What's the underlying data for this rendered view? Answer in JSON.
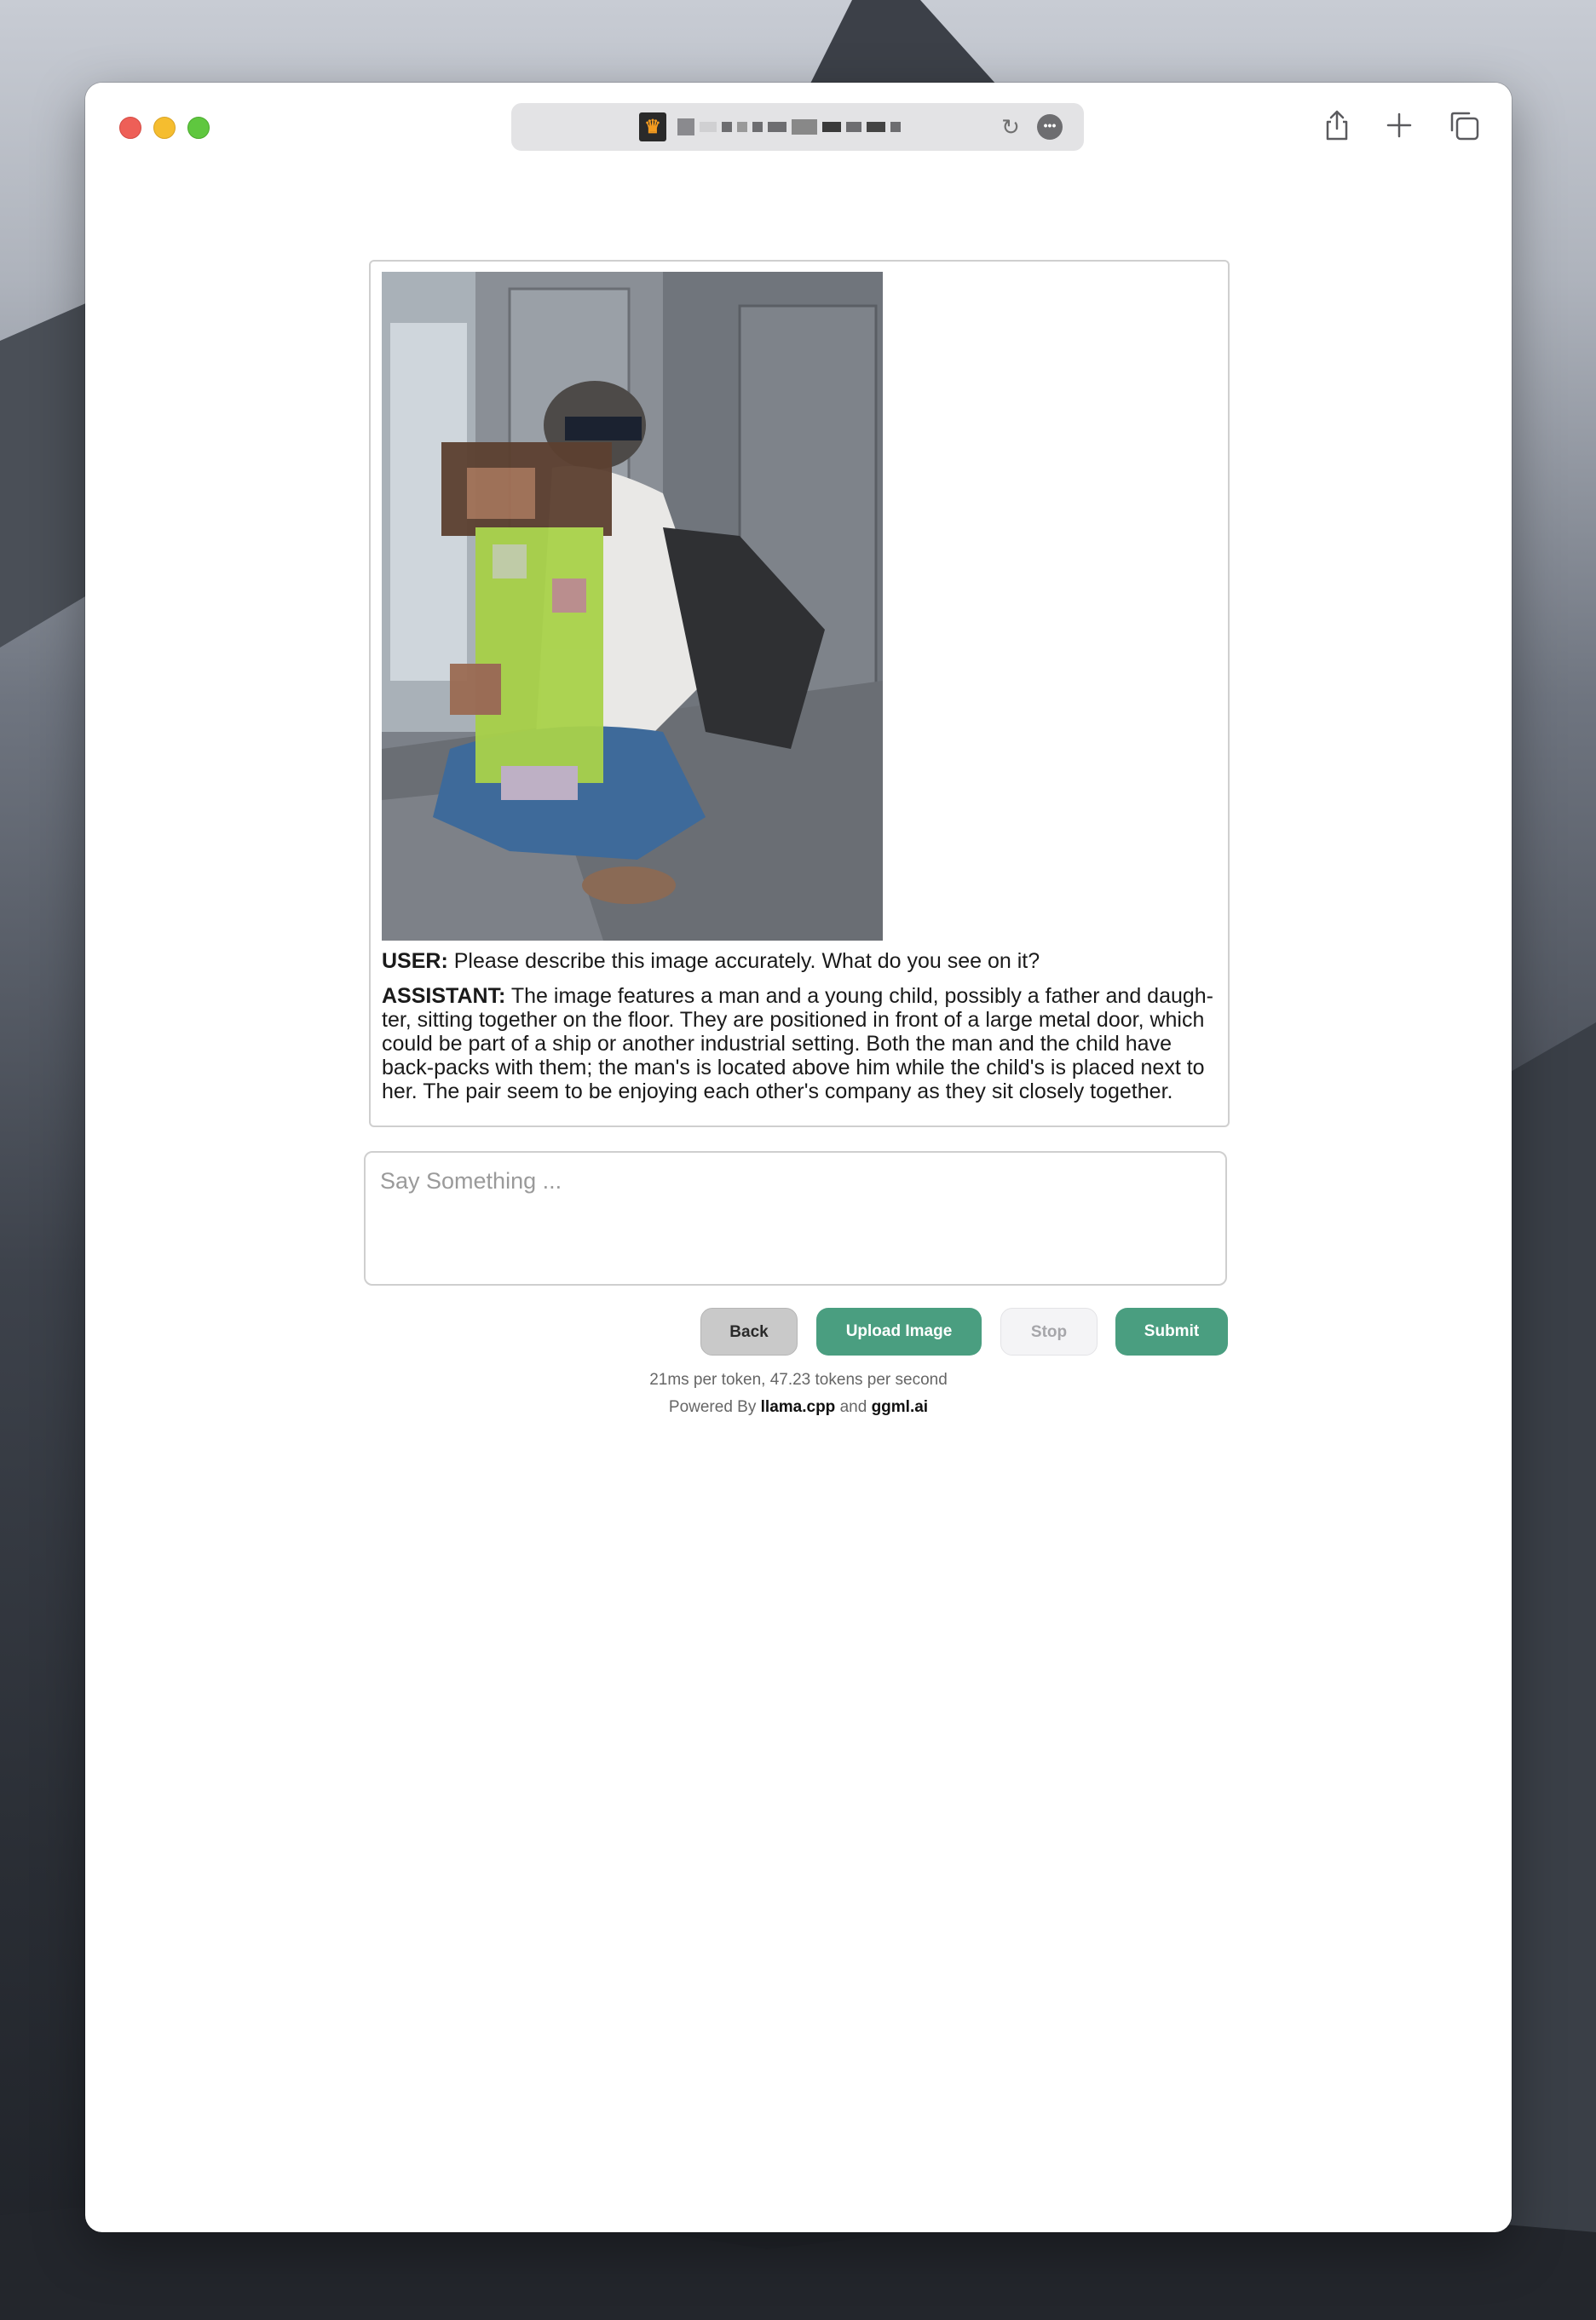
{
  "app": {
    "title": "llama.cpp"
  },
  "browser": {
    "url_masked": true,
    "favicon_glyph": "⟳"
  },
  "chat": {
    "image": {
      "alt": "Man with child in industrial room"
    },
    "user_label": "USER:",
    "user_text": "Please describe this image accurately. What do you see on it?",
    "assistant_label": "ASSISTANT:",
    "assistant_text": "The image features a man and a young child, possibly a father and daugh-ter, sitting together on the floor. They are positioned in front of a large metal door, which could be part of a ship or another industrial setting. Both the man and the child have back-packs with them; the man's is located above him while the child's is placed next to her. The pair seem to be enjoying each other's company as they sit closely together."
  },
  "input": {
    "placeholder": "Say Something ...",
    "value": ""
  },
  "buttons": {
    "back": "Back",
    "upload": "Upload Image",
    "stop": "Stop",
    "submit": "Submit"
  },
  "footer": {
    "stats": "21ms per token, 47.23 tokens per second",
    "powered_prefix": "Powered By ",
    "powered_link1": "llama.cpp",
    "powered_and": " and ",
    "powered_link2": "ggml.ai"
  },
  "colors": {
    "accent": "#4a9e80",
    "close": "#ee5f57",
    "minimize": "#f5bd2f",
    "maximize": "#5fc73f"
  }
}
